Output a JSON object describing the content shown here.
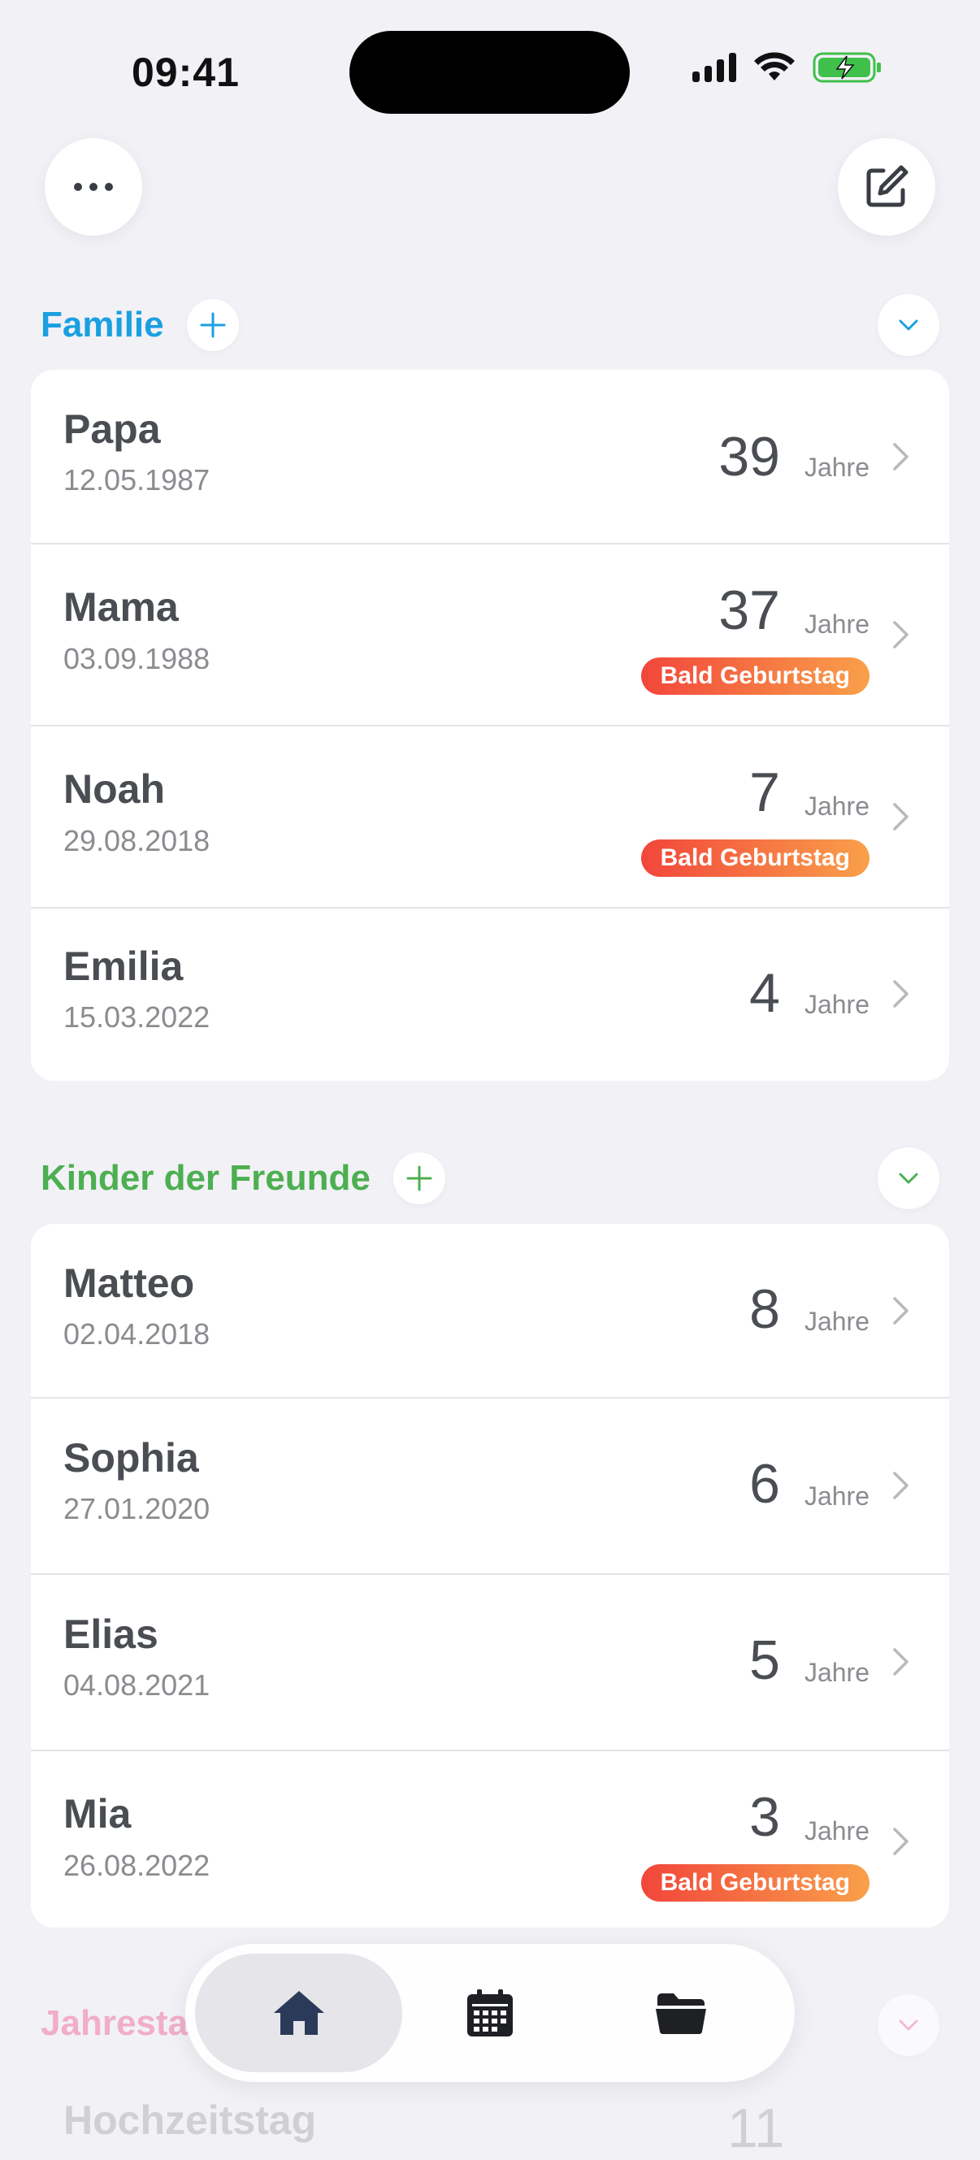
{
  "status_bar": {
    "time": "09:41"
  },
  "sections": [
    {
      "title": "Familie",
      "color": "#1aa0e0",
      "people": [
        {
          "name": "Papa",
          "date": "12.05.1987",
          "age": "39",
          "unit": "Jahre",
          "badge": ""
        },
        {
          "name": "Mama",
          "date": "03.09.1988",
          "age": "37",
          "unit": "Jahre",
          "badge": "Bald Geburtstag"
        },
        {
          "name": "Noah",
          "date": "29.08.2018",
          "age": "7",
          "unit": "Jahre",
          "badge": "Bald Geburtstag"
        },
        {
          "name": "Emilia",
          "date": "15.03.2022",
          "age": "4",
          "unit": "Jahre",
          "badge": ""
        }
      ]
    },
    {
      "title": "Kinder der Freunde",
      "color": "#4caf50",
      "people": [
        {
          "name": "Matteo",
          "date": "02.04.2018",
          "age": "8",
          "unit": "Jahre",
          "badge": ""
        },
        {
          "name": "Sophia",
          "date": "27.01.2020",
          "age": "6",
          "unit": "Jahre",
          "badge": ""
        },
        {
          "name": "Elias",
          "date": "04.08.2021",
          "age": "5",
          "unit": "Jahre",
          "badge": ""
        },
        {
          "name": "Mia",
          "date": "26.08.2022",
          "age": "3",
          "unit": "Jahre",
          "badge": "Bald Geburtstag"
        }
      ]
    }
  ],
  "partial_section": {
    "title": "Jahresta",
    "color": "#f2a3be",
    "first_row_name": "Hochzeitstag",
    "first_row_age": "11"
  },
  "tabbar": {
    "tabs": [
      "home-icon",
      "calendar-icon",
      "folder-icon"
    ],
    "active": "home-icon"
  }
}
